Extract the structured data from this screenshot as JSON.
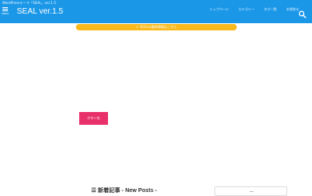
{
  "header": {
    "tagline": "WordPressテーマ「SEAL」ver.1.5",
    "menu_label": "MENU",
    "site_title": "SEAL ver.1.5",
    "nav": [
      "トップページ",
      "カテゴリー",
      "タグ一覧",
      "お問合せ"
    ],
    "search_icon": "search-icon"
  },
  "notice": {
    "text": "✔ SEALの最新情報はこちら"
  },
  "cta": {
    "label": "ボタン名"
  },
  "posts": {
    "label": "☰ 新着記事 - New Posts -"
  },
  "colors": {
    "header_bg": "#1b97e8",
    "notice_bg": "#f9b91b",
    "cta_bg": "#e8306b"
  }
}
